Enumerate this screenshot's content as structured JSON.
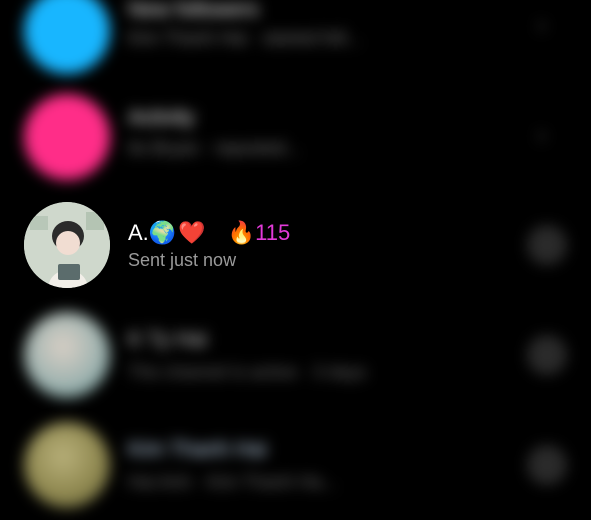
{
  "rows": [
    {
      "title": "New followers",
      "subtitle": "Kim Thanh Hai · started foll..."
    },
    {
      "title": "Activity",
      "subtitle": "Its Bryan · reposted..."
    },
    {
      "title_prefix": "A.",
      "globe": "🌍",
      "heart": "❤️",
      "flame": "🔥",
      "streak": "115",
      "subtitle": "Sent just now"
    },
    {
      "title": "K Ty Hai",
      "subtitle": "The channel is active · 3 days"
    },
    {
      "title": "Kim Thanh Hai",
      "subtitle": "Hai Anh · Kim Thanh Ha..."
    }
  ],
  "icons": {
    "chevron": "chevron-right-icon",
    "camera": "camera-icon"
  },
  "colors": {
    "cyan": "#18b6ff",
    "pink": "#ff2d88",
    "flame": "#e23ad8"
  }
}
